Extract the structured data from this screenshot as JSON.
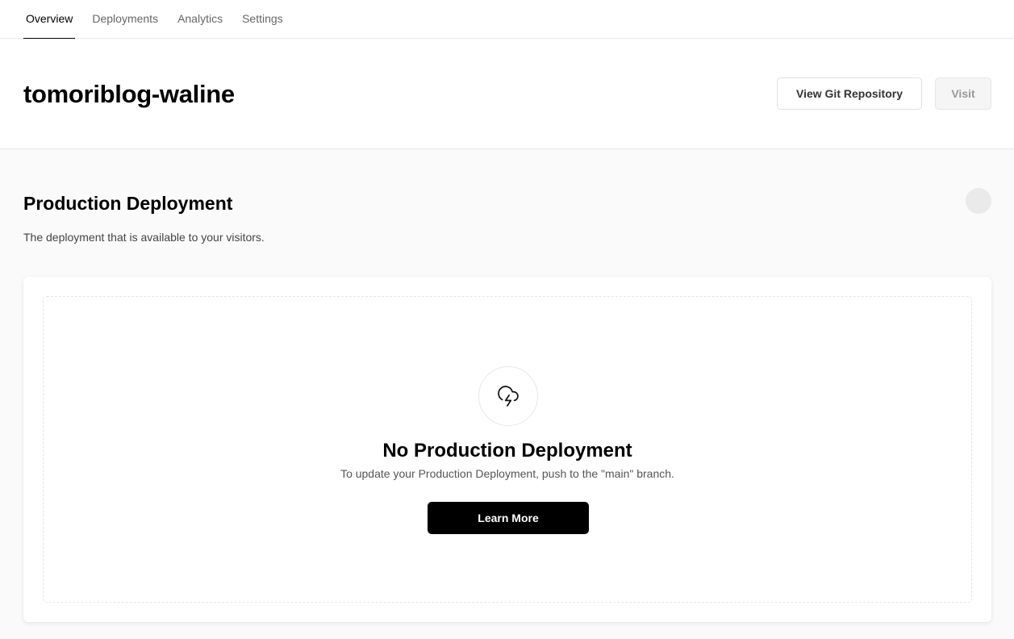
{
  "nav": {
    "tabs": [
      {
        "label": "Overview",
        "active": true
      },
      {
        "label": "Deployments",
        "active": false
      },
      {
        "label": "Analytics",
        "active": false
      },
      {
        "label": "Settings",
        "active": false
      }
    ]
  },
  "header": {
    "project_name": "tomoriblog-waline",
    "view_git_label": "View Git Repository",
    "visit_label": "Visit"
  },
  "production": {
    "title": "Production Deployment",
    "description": "The deployment that is available to your visitors."
  },
  "empty_state": {
    "icon": "cloud-lightning-icon",
    "title": "No Production Deployment",
    "description": "To update your Production Deployment, push to the \"main\" branch.",
    "button_label": "Learn More"
  },
  "colors": {
    "primary_button": "#000000",
    "background": "#fafafa",
    "border": "#eaeaea"
  }
}
